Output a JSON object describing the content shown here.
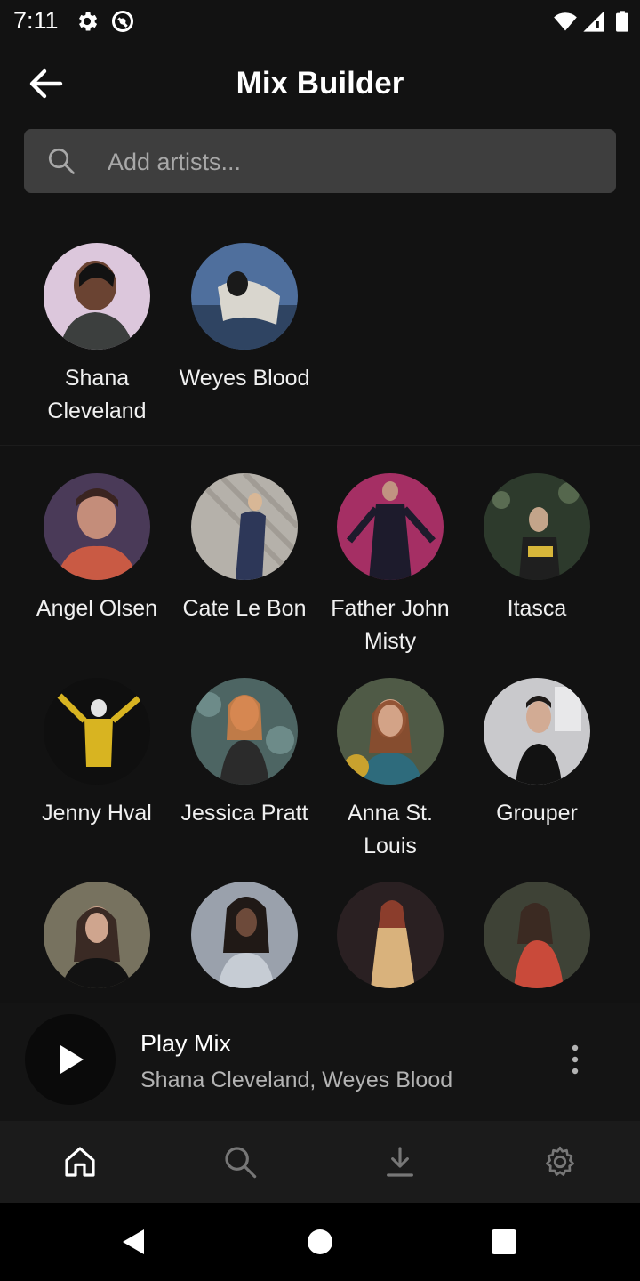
{
  "status": {
    "time": "7:11"
  },
  "header": {
    "title": "Mix Builder"
  },
  "search": {
    "placeholder": "Add artists..."
  },
  "selected_artists": [
    {
      "name": "Shana Cleveland"
    },
    {
      "name": "Weyes Blood"
    }
  ],
  "suggested_artists": [
    {
      "name": "Angel Olsen"
    },
    {
      "name": "Cate Le Bon"
    },
    {
      "name": "Father John Misty"
    },
    {
      "name": "Itasca"
    },
    {
      "name": "Jenny Hval"
    },
    {
      "name": "Jessica Pratt"
    },
    {
      "name": "Anna St. Louis"
    },
    {
      "name": "Grouper"
    }
  ],
  "player": {
    "title": "Play Mix",
    "subtitle": "Shana Cleveland, Weyes Blood"
  },
  "bottom_nav": [
    {
      "icon": "home-icon",
      "active": true
    },
    {
      "icon": "search-icon",
      "active": false
    },
    {
      "icon": "download-icon",
      "active": false
    },
    {
      "icon": "gear-icon",
      "active": false
    }
  ],
  "colors": {
    "background": "#121212",
    "search_bg": "#3e3e3e",
    "text_secondary": "#b3b3b3",
    "nav_bg": "#1b1b1b"
  }
}
